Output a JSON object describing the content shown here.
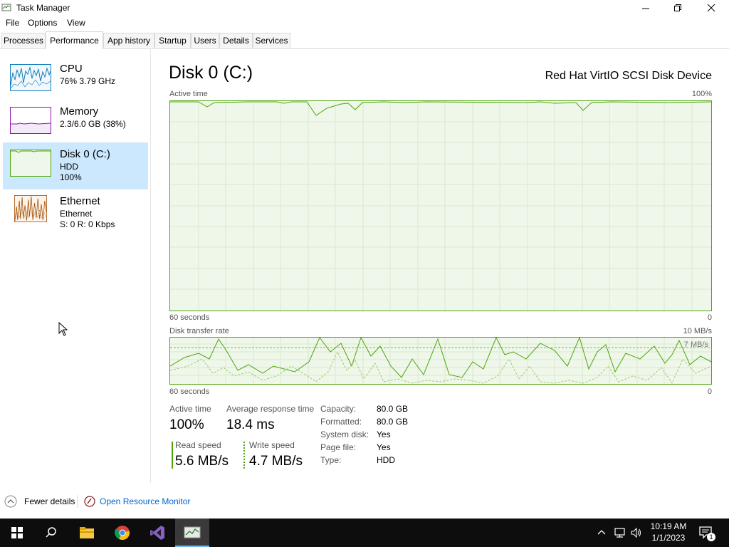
{
  "window": {
    "title": "Task Manager"
  },
  "menu": [
    "File",
    "Options",
    "View"
  ],
  "tabs": [
    "Processes",
    "Performance",
    "App history",
    "Startup",
    "Users",
    "Details",
    "Services"
  ],
  "active_tab": "Performance",
  "sidebar": {
    "items": [
      {
        "title": "CPU",
        "line1": "76% 3.79 GHz",
        "line2": ""
      },
      {
        "title": "Memory",
        "line1": "2.3/6.0 GB (38%)",
        "line2": ""
      },
      {
        "title": "Disk 0 (C:)",
        "line1": "HDD",
        "line2": "100%"
      },
      {
        "title": "Ethernet",
        "line1": "Ethernet",
        "line2": "S: 0 R: 0 Kbps"
      }
    ]
  },
  "main": {
    "title": "Disk 0 (C:)",
    "device": "Red Hat VirtIO SCSI Disk Device",
    "active_time_label": "Active time",
    "active_time_max": "100%",
    "graph1_xleft": "60 seconds",
    "graph1_xright": "0",
    "transfer_label": "Disk transfer rate",
    "transfer_max": "10 MB/s",
    "transfer_mid": "7 MB/s",
    "graph2_xleft": "60 seconds",
    "graph2_xright": "0"
  },
  "stats": {
    "active_time_label": "Active time",
    "active_time_value": "100%",
    "avg_response_label": "Average response time",
    "avg_response_value": "18.4 ms",
    "read_speed_label": "Read speed",
    "read_speed_value": "5.6 MB/s",
    "write_speed_label": "Write speed",
    "write_speed_value": "4.7 MB/s"
  },
  "info": [
    {
      "label": "Capacity:",
      "value": "80.0 GB"
    },
    {
      "label": "Formatted:",
      "value": "80.0 GB"
    },
    {
      "label": "System disk:",
      "value": "Yes"
    },
    {
      "label": "Page file:",
      "value": "Yes"
    },
    {
      "label": "Type:",
      "value": "HDD"
    }
  ],
  "footer": {
    "fewer_details": "Fewer details",
    "open_resource_monitor": "Open Resource Monitor"
  },
  "taskbar": {
    "time": "10:19 AM",
    "date": "1/1/2023",
    "notification_count": "1",
    "icons": [
      "windows-start-icon",
      "search-icon",
      "file-explorer-icon",
      "chrome-icon",
      "visual-studio-icon",
      "task-manager-icon"
    ]
  },
  "colors": {
    "disk_accent": "#4da60c",
    "disk_fill": "#eff7ea",
    "cpu_accent": "#117dbb",
    "memory_accent": "#8b12ae",
    "ethernet_accent": "#a74f01",
    "selected_bg": "#cce8ff",
    "link": "#0066cc"
  }
}
